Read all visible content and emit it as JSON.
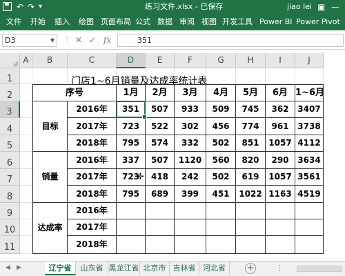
{
  "titlebar": {
    "filename": "练习文件.xlsx",
    "separator": "-",
    "status": "已保存",
    "user": "jiao lei",
    "undo_glyph": "↶",
    "redo_glyph": "↷",
    "qa_more_glyph": "▾",
    "options_glyph": "▣",
    "minimize_glyph": "—"
  },
  "ribbon": {
    "tabs": [
      "文件",
      "开始",
      "插入",
      "绘图",
      "页面布局",
      "公式",
      "数据",
      "审阅",
      "视图",
      "开发工具",
      "Power BI",
      "Power Pivot"
    ]
  },
  "formula_bar": {
    "name_box": "D3",
    "name_box_dropdown": "▼",
    "dots": "⋮",
    "cancel_glyph": "✕",
    "confirm_glyph": "✓",
    "fx_glyph": "fx",
    "value": "351"
  },
  "grid": {
    "columns": [
      "A",
      "B",
      "C",
      "D",
      "E",
      "F",
      "G",
      "H",
      "I",
      "J"
    ],
    "rows": [
      "1",
      "2",
      "3",
      "4",
      "5",
      "6",
      "7",
      "8",
      "9",
      "10",
      "11"
    ],
    "selected_column": "D",
    "selected_row": "3",
    "title": "门店1~6月销量及达成率统计表",
    "headers": [
      "序号",
      "",
      "1月",
      "2月",
      "3月",
      "4月",
      "5月",
      "6月",
      "1~6月"
    ],
    "groups": [
      {
        "label": "目标",
        "rows": [
          {
            "year": "2016年",
            "values": [
              "351",
              "507",
              "933",
              "509",
              "745",
              "362",
              "3407"
            ]
          },
          {
            "year": "2017年",
            "values": [
              "723",
              "522",
              "302",
              "456",
              "774",
              "961",
              "3738"
            ]
          },
          {
            "year": "2018年",
            "values": [
              "795",
              "574",
              "332",
              "502",
              "851",
              "1057",
              "4112"
            ]
          }
        ]
      },
      {
        "label": "销量",
        "rows": [
          {
            "year": "2016年",
            "values": [
              "337",
              "507",
              "1120",
              "560",
              "820",
              "290",
              "3634"
            ]
          },
          {
            "year": "2017年",
            "values": [
              "723",
              "418",
              "242",
              "502",
              "619",
              "1057",
              "3561"
            ]
          },
          {
            "year": "2018年",
            "values": [
              "795",
              "689",
              "399",
              "451",
              "1022",
              "1163",
              "4519"
            ]
          }
        ]
      },
      {
        "label": "达成率",
        "rows": [
          {
            "year": "2016年",
            "values": [
              "",
              "",
              "",
              "",
              "",
              "",
              ""
            ]
          },
          {
            "year": "2017年",
            "values": [
              "",
              "",
              "",
              "",
              "",
              "",
              ""
            ]
          },
          {
            "year": "2018年",
            "values": [
              "",
              "",
              "",
              "",
              "",
              "",
              ""
            ]
          }
        ]
      }
    ]
  },
  "sheet_tabs": {
    "prev_glyph": "◀",
    "next_glyph": "▶",
    "tabs": [
      "辽宁省",
      "山东省",
      "黑龙江省",
      "北京市",
      "吉林省",
      "河北省"
    ],
    "active": "辽宁省",
    "add_glyph": "+",
    "more_glyph": "⋮"
  },
  "colors": {
    "accent": "#217346"
  }
}
